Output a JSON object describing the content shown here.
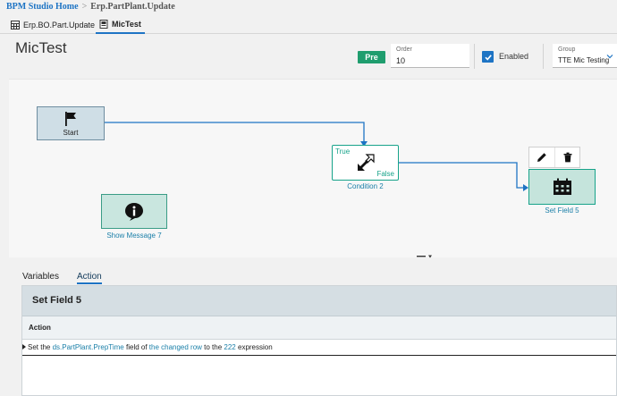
{
  "breadcrumb": {
    "home": "BPM Studio Home",
    "separator": ">",
    "current": "Erp.PartPlant.Update"
  },
  "tabs": [
    {
      "label": "Erp.BO.Part.Update",
      "icon": "grid-icon"
    },
    {
      "label": "MicTest",
      "icon": "document-icon",
      "active": true
    }
  ],
  "header": {
    "title": "MicTest",
    "badge": "Pre",
    "order": {
      "label": "Order",
      "value": "10"
    },
    "enabled": {
      "label": "Enabled",
      "checked": true
    },
    "group": {
      "label": "Group",
      "value": "TTE Mic Testing"
    }
  },
  "workflow": {
    "start": {
      "label": "Start",
      "icon": "flag-icon"
    },
    "condition": {
      "label": "Condition 2",
      "icon": "condition-arrows-icon",
      "true_label": "True",
      "false_label": "False"
    },
    "message": {
      "label": "Show Message 7",
      "icon": "info-bubble-icon"
    },
    "setfield": {
      "label": "Set Field 5",
      "icon": "calendar-icon"
    },
    "toolbox": {
      "edit_icon": "pencil-icon",
      "delete_icon": "trash-icon"
    }
  },
  "bottom": {
    "tabs": [
      {
        "label": "Variables"
      },
      {
        "label": "Action",
        "active": true
      }
    ],
    "panel_title": "Set Field 5",
    "column_header": "Action",
    "row": {
      "t1": "Set the ",
      "field": "ds.PartPlant.PrepTime",
      "t2": " field of ",
      "target": "the changed row",
      "t3": " to the ",
      "expr": "222",
      "t4": " expression"
    }
  },
  "colors": {
    "accent": "#1e74c4",
    "teal": "#17a38a",
    "badge": "#1f9d6e"
  }
}
